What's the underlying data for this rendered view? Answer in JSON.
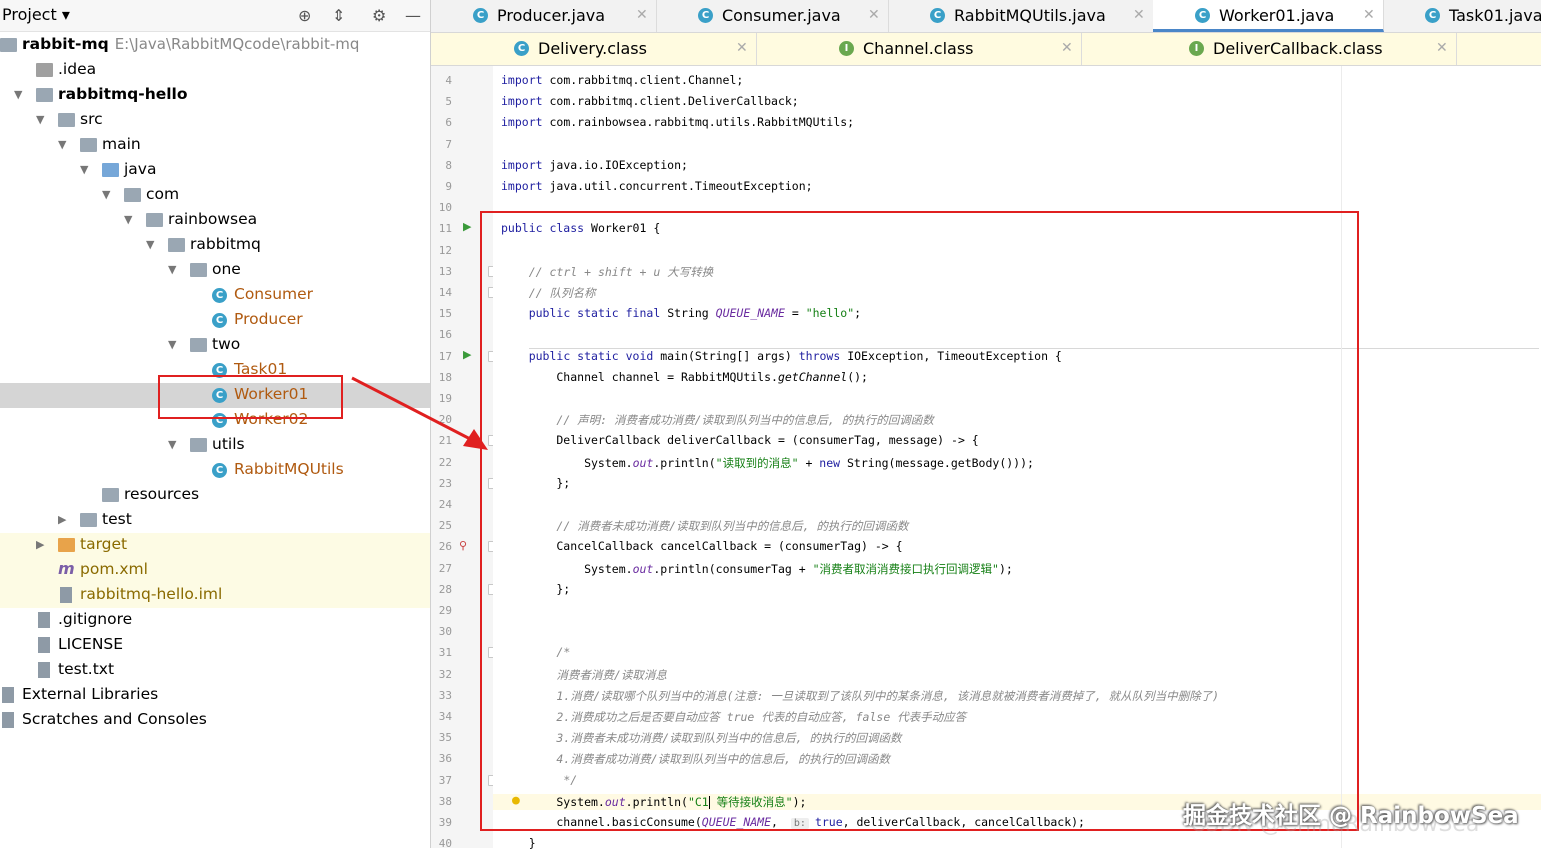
{
  "sidebar": {
    "title": "Project",
    "tree": [
      {
        "label": "rabbit-mq",
        "path": "E:\\Java\\RabbitMQcode\\rabbit-mq",
        "depth": 0,
        "icon": "module-folder",
        "bold": true
      },
      {
        "label": ".idea",
        "depth": 1,
        "icon": "folder-idea"
      },
      {
        "label": "rabbitmq-hello",
        "depth": 1,
        "icon": "module-folder",
        "bold": true,
        "arrow": "down"
      },
      {
        "label": "src",
        "depth": 2,
        "icon": "folder",
        "arrow": "down"
      },
      {
        "label": "main",
        "depth": 3,
        "icon": "folder",
        "arrow": "down"
      },
      {
        "label": "java",
        "depth": 4,
        "icon": "folder-src",
        "arrow": "down"
      },
      {
        "label": "com",
        "depth": 5,
        "icon": "package",
        "arrow": "down"
      },
      {
        "label": "rainbowsea",
        "depth": 6,
        "icon": "package",
        "arrow": "down"
      },
      {
        "label": "rabbitmq",
        "depth": 7,
        "icon": "package",
        "arrow": "down"
      },
      {
        "label": "one",
        "depth": 8,
        "icon": "package",
        "arrow": "down"
      },
      {
        "label": "Consumer",
        "depth": 9,
        "icon": "class",
        "color": "#b05a10"
      },
      {
        "label": "Producer",
        "depth": 9,
        "icon": "class",
        "color": "#b05a10"
      },
      {
        "label": "two",
        "depth": 8,
        "icon": "package",
        "arrow": "down"
      },
      {
        "label": "Task01",
        "depth": 9,
        "icon": "class",
        "color": "#b05a10"
      },
      {
        "label": "Worker01",
        "depth": 9,
        "icon": "class",
        "color": "#b05a10",
        "selected": true
      },
      {
        "label": "Worker02",
        "depth": 9,
        "icon": "class",
        "color": "#b05a10"
      },
      {
        "label": "utils",
        "depth": 8,
        "icon": "package",
        "arrow": "down"
      },
      {
        "label": "RabbitMQUtils",
        "depth": 9,
        "icon": "class",
        "color": "#b05a10"
      },
      {
        "label": "resources",
        "depth": 4,
        "icon": "folder-res"
      },
      {
        "label": "test",
        "depth": 3,
        "icon": "folder",
        "arrow": "right"
      },
      {
        "label": "target",
        "depth": 2,
        "icon": "folder-target",
        "arrow": "right",
        "color": "#8a6a00",
        "highlight": true
      },
      {
        "label": "pom.xml",
        "depth": 2,
        "icon": "maven",
        "color": "#8a6a00",
        "highlight": true
      },
      {
        "label": "rabbitmq-hello.iml",
        "depth": 2,
        "icon": "file",
        "color": "#8a6a00",
        "highlight": true
      },
      {
        "label": ".gitignore",
        "depth": 1,
        "icon": "file"
      },
      {
        "label": "LICENSE",
        "depth": 1,
        "icon": "file"
      },
      {
        "label": "test.txt",
        "depth": 1,
        "icon": "file"
      },
      {
        "label": "External Libraries",
        "depth": 0,
        "icon": "libraries"
      },
      {
        "label": "Scratches and Consoles",
        "depth": 0,
        "icon": "scratches"
      }
    ]
  },
  "tabs_row1": [
    {
      "label": "Producer.java",
      "icon": "class"
    },
    {
      "label": "Consumer.java",
      "icon": "class"
    },
    {
      "label": "RabbitMQUtils.java",
      "icon": "class"
    },
    {
      "label": "Worker01.java",
      "icon": "class",
      "active": true
    },
    {
      "label": "Task01.java",
      "icon": "class"
    }
  ],
  "tabs_row2": [
    {
      "label": "Delivery.class",
      "icon": "class"
    },
    {
      "label": "Channel.class",
      "icon": "interface"
    },
    {
      "label": "DeliverCallback.class",
      "icon": "interface"
    }
  ],
  "code_lines": [
    {
      "n": "4",
      "html": "<span class='kw'>import</span> com.rabbitmq.client.Channel;"
    },
    {
      "n": "5",
      "html": "<span class='kw'>import</span> com.rabbitmq.client.DeliverCallback;"
    },
    {
      "n": "6",
      "html": "<span class='kw'>import</span> com.rainbowsea.rabbitmq.utils.RabbitMQUtils;"
    },
    {
      "n": "7",
      "html": ""
    },
    {
      "n": "8",
      "html": "<span class='kw'>import</span> java.io.IOException;"
    },
    {
      "n": "9",
      "html": "<span class='kw'>import</span> java.util.concurrent.TimeoutException;"
    },
    {
      "n": "10",
      "html": ""
    },
    {
      "n": "11",
      "html": "<span class='kw'>public class</span> Worker01 {"
    },
    {
      "n": "12",
      "html": ""
    },
    {
      "n": "13",
      "html": "    <span class='cm'>// ctrl + shift + u 大写转换</span>"
    },
    {
      "n": "14",
      "html": "    <span class='cm'>// 队列名称</span>"
    },
    {
      "n": "15",
      "html": "    <span class='kw'>public static final</span> String <span class='it'>QUEUE_NAME</span> = <span class='st'>\"hello\"</span>;"
    },
    {
      "n": "16",
      "html": ""
    },
    {
      "n": "17",
      "html": "    <span class='kw'>public static void</span> main(String[] args) <span class='kw'>throws</span> IOException, TimeoutException {"
    },
    {
      "n": "18",
      "html": "        Channel channel = RabbitMQUtils.<span class='mt'>getChannel</span>();"
    },
    {
      "n": "19",
      "html": ""
    },
    {
      "n": "20",
      "html": "        <span class='cm'>// 声明: 消费者成功消费/读取到队列当中的信息后, 的执行的回调函数</span>"
    },
    {
      "n": "21",
      "html": "        DeliverCallback deliverCallback = (consumerTag, message) -> {"
    },
    {
      "n": "22",
      "html": "            System.<span class='fld'>out</span>.println(<span class='st'>\"读取到的消息\"</span> + <span class='kw'>new</span> String(message.getBody()));"
    },
    {
      "n": "23",
      "html": "        };"
    },
    {
      "n": "24",
      "html": ""
    },
    {
      "n": "25",
      "html": "        <span class='cm'>// 消费者未成功消费/读取到队列当中的信息后, 的执行的回调函数</span>"
    },
    {
      "n": "26",
      "html": "        CancelCallback cancelCallback = (consumerTag) -> {"
    },
    {
      "n": "27",
      "html": "            System.<span class='fld'>out</span>.println(consumerTag + <span class='st'>\"消费者取消消费接口执行回调逻辑\"</span>);"
    },
    {
      "n": "28",
      "html": "        };"
    },
    {
      "n": "29",
      "html": ""
    },
    {
      "n": "30",
      "html": ""
    },
    {
      "n": "31",
      "html": "        <span class='cm'>/*</span>"
    },
    {
      "n": "32",
      "html": "        <span class='cm'>消费者消费/读取消息</span>"
    },
    {
      "n": "33",
      "html": "        <span class='cm'>1.消费/读取哪个队列当中的消息(注意: 一旦读取到了该队列中的某条消息, 该消息就被消费者消费掉了, 就从队列当中删除了)</span>"
    },
    {
      "n": "34",
      "html": "        <span class='cm'>2.消费成功之后是否要自动应答 true 代表的自动应答, false 代表手动应答</span>"
    },
    {
      "n": "35",
      "html": "        <span class='cm'>3.消费者未成功消费/读取到队列当中的信息后, 的执行的回调函数</span>"
    },
    {
      "n": "36",
      "html": "        <span class='cm'>4.消费者成功消费/读取到队列当中的信息后, 的执行的回调函数</span>"
    },
    {
      "n": "37",
      "html": "         <span class='cm'>*/</span>"
    },
    {
      "n": "38",
      "html": "        System.<span class='fld'>out</span>.println(<span class='st'>\"C1</span><span id='cursor'></span> <span class='st'>等待接收消息\"</span>);"
    },
    {
      "n": "39",
      "html": "        channel.basicConsume(<span class='it'>QUEUE_NAME</span>, <span class='hint'>b:</span><span class='kw'>true</span>, deliverCallback, cancelCallback);"
    },
    {
      "n": "40",
      "html": "    }"
    }
  ],
  "watermark": {
    "text": "掘金技术社区 @ RainbowSea",
    "sub": "CSDN @ChinaRainbowSea"
  },
  "colors": {
    "annotation_red": "#e02020",
    "selection": "#d5d5d5",
    "active_tab_underline": "#4a86c8"
  }
}
